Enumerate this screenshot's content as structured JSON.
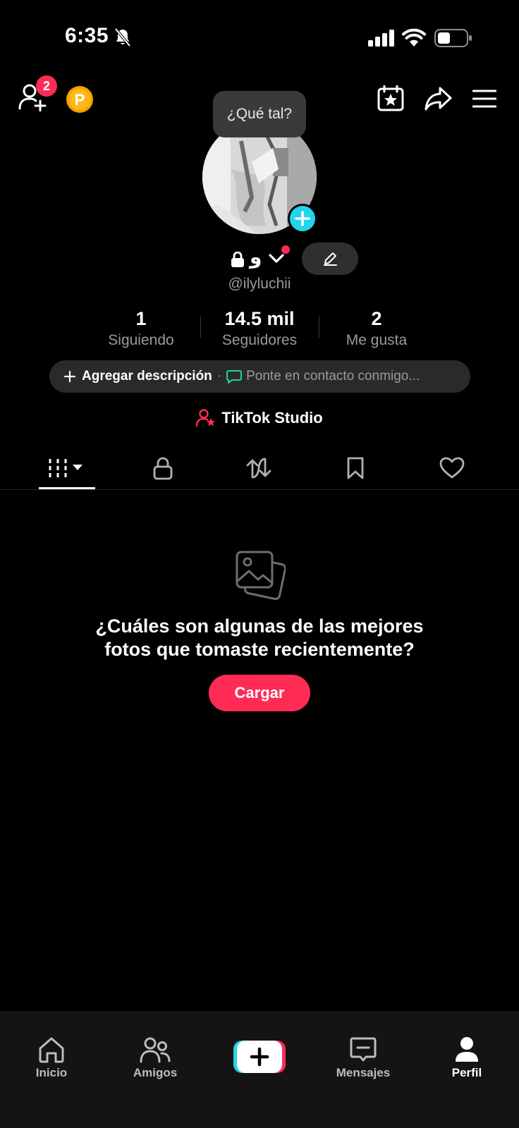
{
  "status_bar": {
    "time": "6:35",
    "icons": [
      "bell-off-icon",
      "signal-icon",
      "wifi-icon",
      "battery-icon"
    ]
  },
  "top_bar": {
    "friend_badge_count": "2",
    "icons": [
      "add-friend-icon",
      "coin-icon",
      "calendar-star-icon",
      "share-icon",
      "menu-icon"
    ],
    "coin_letter": "P"
  },
  "profile": {
    "bubble_text": "¿Qué tal?",
    "display_name": "و",
    "username": "@ilyluchii"
  },
  "stats": [
    {
      "value": "1",
      "label": "Siguiendo"
    },
    {
      "value": "14.5 mil",
      "label": "Seguidores"
    },
    {
      "value": "2",
      "label": "Me gusta"
    }
  ],
  "description": {
    "add_label": "Agregar descripción",
    "separator": "·",
    "contact_label": "Ponte en contacto conmigo..."
  },
  "studio_label": "TikTok Studio",
  "tabs": [
    "videos-grid-icon",
    "lock-icon",
    "repost-icon",
    "bookmark-icon",
    "heart-icon"
  ],
  "empty_state": {
    "line1": "¿Cuáles son algunas de las mejores",
    "line2": "fotos que tomaste recientemente?",
    "button": "Cargar"
  },
  "bottom_nav": {
    "items": [
      {
        "label": "Inicio",
        "icon": "home-icon"
      },
      {
        "label": "Amigos",
        "icon": "friends-icon"
      },
      {
        "label": "",
        "icon": "create-plus-icon"
      },
      {
        "label": "Mensajes",
        "icon": "messages-icon"
      },
      {
        "label": "Perfil",
        "icon": "profile-icon"
      }
    ],
    "active": "Perfil"
  },
  "colors": {
    "accent": "#fe2c55",
    "cyan": "#20d5ec",
    "background": "#000000",
    "pill": "#2a2a2a"
  }
}
